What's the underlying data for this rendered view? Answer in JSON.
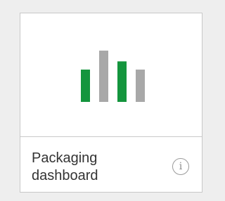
{
  "tile": {
    "title": "Packaging dashboard",
    "icon": "bar-chart-icon",
    "info_icon": "info-icon",
    "info_glyph": "i"
  },
  "colors": {
    "bar_green": "#14953d",
    "bar_gray": "#a8a8a8",
    "background": "#eeeeee",
    "tile_border": "#c8c8c8",
    "text": "#333333"
  },
  "chart_icon": {
    "bars": [
      {
        "color_key": "bar_green",
        "level": 0.63
      },
      {
        "color_key": "bar_gray",
        "level": 1.0
      },
      {
        "color_key": "bar_green",
        "level": 0.79
      },
      {
        "color_key": "bar_gray",
        "level": 0.63
      }
    ]
  }
}
